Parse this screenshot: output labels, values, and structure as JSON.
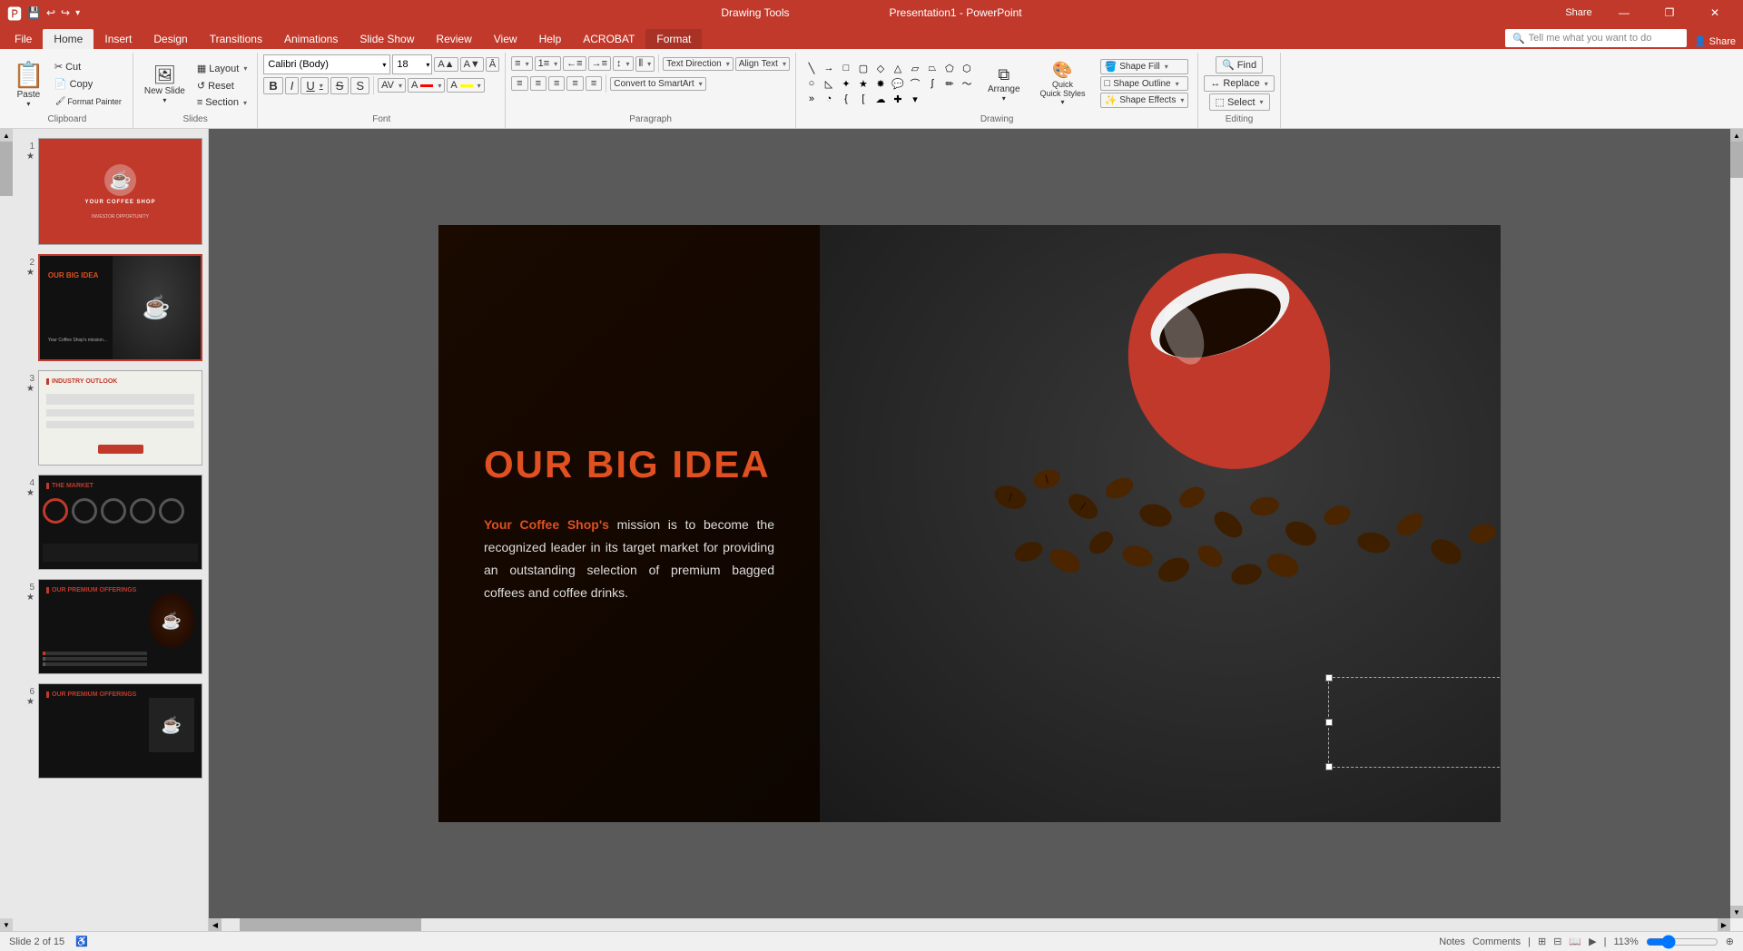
{
  "titlebar": {
    "app_title": "Presentation1 - PowerPoint",
    "drawing_tools": "Drawing Tools",
    "quick_access": [
      "Save",
      "Undo",
      "Redo",
      "Customize"
    ],
    "window_controls": [
      "Minimize",
      "Restore",
      "Close"
    ],
    "share_label": "Share"
  },
  "ribbon": {
    "tabs": [
      "File",
      "Home",
      "Insert",
      "Design",
      "Transitions",
      "Animations",
      "Slide Show",
      "Review",
      "View",
      "Help",
      "ACROBAT",
      "Format"
    ],
    "active_tab": "Home",
    "format_tab": "Format",
    "groups": {
      "clipboard": {
        "label": "Clipboard",
        "paste": "Paste",
        "cut": "Cut",
        "copy": "Copy",
        "format_painter": "Format Painter"
      },
      "slides": {
        "label": "Slides",
        "new_slide": "New Slide",
        "layout": "Layout",
        "reset": "Reset",
        "section": "Section"
      },
      "font": {
        "label": "Font",
        "name": "Calibri (Body)",
        "size": "18",
        "bold": "B",
        "italic": "I",
        "underline": "U",
        "strikethrough": "S",
        "shadow": "S",
        "char_spacing": "AV",
        "font_color": "A",
        "highlight": "A"
      },
      "paragraph": {
        "label": "Paragraph",
        "bullets": "Bullets",
        "numbering": "Numbering",
        "decrease_indent": "Decrease Indent",
        "increase_indent": "Increase Indent",
        "line_spacing": "Line Spacing",
        "columns": "Columns",
        "text_direction": "Text Direction",
        "align_text": "Align Text",
        "convert_smartart": "Convert to SmartArt",
        "align_left": "Left",
        "center": "Center",
        "align_right": "Right",
        "justify": "Justify",
        "dist": "Distributed"
      },
      "drawing": {
        "label": "Drawing",
        "shapes": "Shapes",
        "arrange": "Arrange",
        "quick_styles": "Quick Styles",
        "shape_fill": "Shape Fill",
        "shape_outline": "Shape Outline",
        "shape_effects": "Shape Effects"
      },
      "editing": {
        "label": "Editing",
        "find": "Find",
        "replace": "Replace",
        "select": "Select"
      }
    }
  },
  "slides": {
    "current": 2,
    "total": 15,
    "items": [
      {
        "number": "1",
        "label": "Slide 1",
        "type": "cover"
      },
      {
        "number": "2",
        "label": "Slide 2",
        "type": "big_idea",
        "active": true
      },
      {
        "number": "3",
        "label": "Slide 3",
        "type": "industry"
      },
      {
        "number": "4",
        "label": "Slide 4",
        "type": "market"
      },
      {
        "number": "5",
        "label": "Slide 5",
        "type": "offerings1"
      },
      {
        "number": "6",
        "label": "Slide 6",
        "type": "offerings2"
      }
    ]
  },
  "slide_content": {
    "title": "OUR BIG IDEA",
    "body_highlight": "Your Coffee Shop's",
    "body_text": " mission is to become the recognized leader in its target market for providing an outstanding selection of premium bagged coffees and coffee drinks.",
    "title_color": "#e05020",
    "highlight_color": "#e05020"
  },
  "statusbar": {
    "slide_info": "Slide 2 of 15",
    "notes": "Notes",
    "comments": "Comments",
    "view_normal": "Normal",
    "view_outline": "Outline",
    "view_slide_sorter": "Slide Sorter",
    "view_reading": "Reading View",
    "zoom": "113%"
  },
  "search": {
    "placeholder": "Tell me what you want to do"
  }
}
